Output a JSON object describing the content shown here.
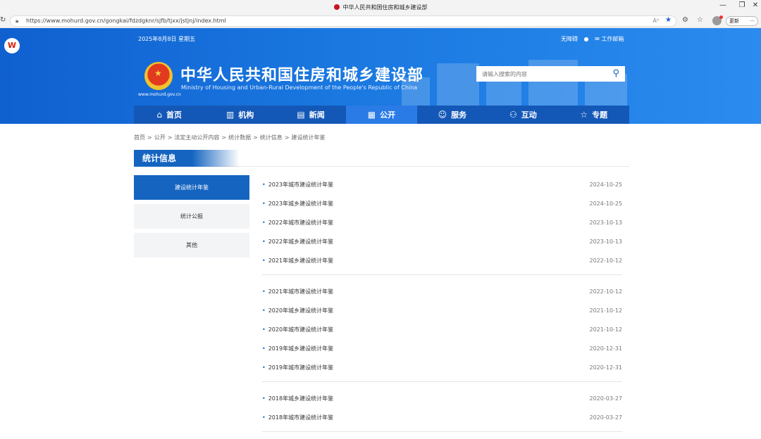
{
  "browser": {
    "tab_title": "中华人民共和国住房和城乡建设部",
    "url": "https://www.mohurd.gov.cn/gongkai/fdzdgknr/sjfb/tjxx/jstjnj/index.html",
    "update_label": "更新",
    "reader_glyph": "A⁰",
    "controls": {
      "minimize": "—",
      "restore": "❐",
      "close": "✕"
    }
  },
  "header": {
    "date": "2025年8月8日 星期五",
    "accessibility": "无障碍",
    "wechat_glyph": "●",
    "mail": "✉ 工作邮箱",
    "title": "中华人民共和国住房和城乡建设部",
    "subtitle": "Ministry of Housing and Urban-Rural Development of the People's Republic of China",
    "site_url": "www.mohurd.gov.cn",
    "search_placeholder": "请输入搜索的内容"
  },
  "nav": [
    {
      "label": "首页",
      "icon": "home-icon",
      "glyph": "⌂"
    },
    {
      "label": "机构",
      "icon": "building-icon",
      "glyph": "▥"
    },
    {
      "label": "新闻",
      "icon": "news-icon",
      "glyph": "▤"
    },
    {
      "label": "公开",
      "icon": "document-icon",
      "glyph": "▦"
    },
    {
      "label": "服务",
      "icon": "user-service-icon",
      "glyph": "☺"
    },
    {
      "label": "互动",
      "icon": "interaction-icon",
      "glyph": "⚇"
    },
    {
      "label": "专题",
      "icon": "topic-star-icon",
      "glyph": "☆"
    }
  ],
  "nav_active": "公开",
  "breadcrumb": [
    "首页",
    ">",
    "公开",
    ">",
    "法定主动公开内容",
    ">",
    "统计数据",
    ">",
    "统计信息",
    ">",
    "建设统计年鉴"
  ],
  "section_title": "统计信息",
  "sidebar": [
    {
      "label": "建设统计年鉴",
      "active": true
    },
    {
      "label": "统计公报",
      "active": false
    },
    {
      "label": "其他",
      "active": false
    }
  ],
  "groups": [
    [
      {
        "title": "2023年城市建设统计年鉴",
        "date": "2024-10-25"
      },
      {
        "title": "2023年城乡建设统计年鉴",
        "date": "2024-10-25"
      },
      {
        "title": "2022年城市建设统计年鉴",
        "date": "2023-10-13"
      },
      {
        "title": "2022年城乡建设统计年鉴",
        "date": "2023-10-13"
      },
      {
        "title": "2021年城乡建设统计年鉴",
        "date": "2022-10-12"
      }
    ],
    [
      {
        "title": "2021年城市建设统计年鉴",
        "date": "2022-10-12"
      },
      {
        "title": "2020年城乡建设统计年鉴",
        "date": "2021-10-12"
      },
      {
        "title": "2020年城市建设统计年鉴",
        "date": "2021-10-12"
      },
      {
        "title": "2019年城乡建设统计年鉴",
        "date": "2020-12-31"
      },
      {
        "title": "2019年城市建设统计年鉴",
        "date": "2020-12-31"
      }
    ],
    [
      {
        "title": "2018年城乡建设统计年鉴",
        "date": "2020-03-27"
      },
      {
        "title": "2018年城市建设统计年鉴",
        "date": "2020-03-27"
      }
    ]
  ],
  "colors": {
    "brand_blue": "#1565c0",
    "nav_blue": "#1458b7",
    "header_blue": "#1a78e0"
  }
}
